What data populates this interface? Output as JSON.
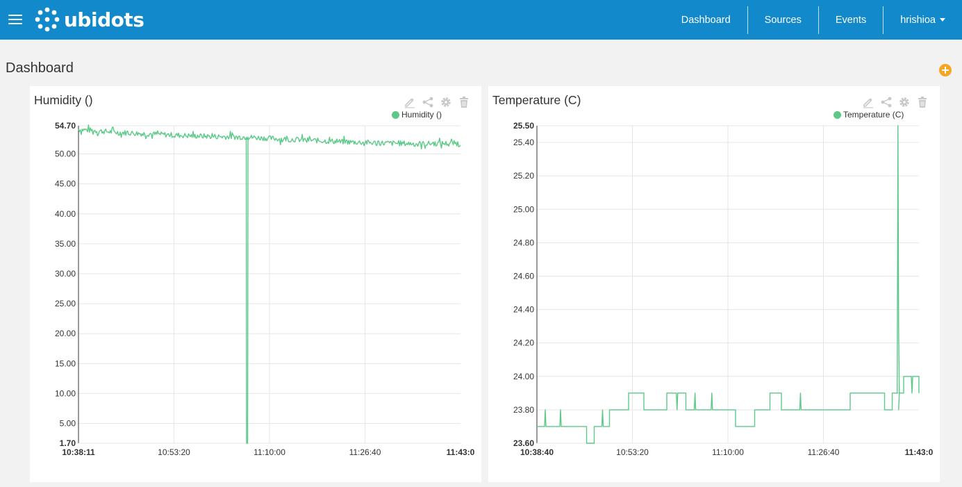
{
  "app": {
    "brand": "ubidots",
    "accent": "#1289ca"
  },
  "nav": {
    "dashboard": "Dashboard",
    "sources": "Sources",
    "events": "Events",
    "user": "hrishioa"
  },
  "page": {
    "title": "Dashboard"
  },
  "tools": [
    "edit-icon",
    "share-icon",
    "gear-icon",
    "trash-icon"
  ],
  "widgets": [
    {
      "title": "Humidity ()",
      "legend": "Humidity ()",
      "color": "#5bc987"
    },
    {
      "title": "Temperature (C)",
      "legend": "Temperature (C)",
      "color": "#5bc987"
    }
  ],
  "chart_data": [
    {
      "type": "line",
      "title": "Humidity ()",
      "series": [
        {
          "name": "Humidity ()"
        }
      ],
      "ylim": [
        1.7,
        54.7
      ],
      "yticks": [
        "1.70",
        "5.00",
        "10.00",
        "15.00",
        "20.00",
        "25.00",
        "30.00",
        "35.00",
        "40.00",
        "45.00",
        "50.00",
        "54.70"
      ],
      "xticks": [
        "10:38:11",
        "10:53:20",
        "11:10:00",
        "11:26:40",
        "11:43:0"
      ],
      "grid": true,
      "legend_position": "top-right",
      "x_range": [
        "10:38:11",
        "11:43:0"
      ],
      "baseline": [
        [
          0,
          54.1
        ],
        [
          0.1,
          53.6
        ],
        [
          0.2,
          53.3
        ],
        [
          0.3,
          53.0
        ],
        [
          0.44,
          52.8
        ],
        [
          0.5,
          52.6
        ],
        [
          0.6,
          52.3
        ],
        [
          0.7,
          52.0
        ],
        [
          0.8,
          51.8
        ],
        [
          0.9,
          51.7
        ],
        [
          1.0,
          51.8
        ]
      ],
      "noise": 0.45,
      "spikes": [
        {
          "x": 0.44,
          "y": 1.7
        }
      ]
    },
    {
      "type": "line",
      "title": "Temperature (C)",
      "series": [
        {
          "name": "Temperature (C)"
        }
      ],
      "ylim": [
        23.6,
        25.5
      ],
      "yticks": [
        "23.60",
        "23.80",
        "24.00",
        "24.20",
        "24.40",
        "24.60",
        "24.80",
        "25.00",
        "25.20",
        "25.40",
        "25.50"
      ],
      "xticks": [
        "10:38:40",
        "10:53:20",
        "11:10:00",
        "11:26:40",
        "11:43:0"
      ],
      "grid": true,
      "legend_position": "top-right",
      "x_range": [
        "10:38:40",
        "11:43:0"
      ],
      "steps": [
        [
          0.0,
          23.7
        ],
        [
          0.1,
          23.7
        ],
        [
          0.13,
          23.6
        ],
        [
          0.15,
          23.7
        ],
        [
          0.19,
          23.8
        ],
        [
          0.24,
          23.9
        ],
        [
          0.28,
          23.8
        ],
        [
          0.34,
          23.9
        ],
        [
          0.39,
          23.8
        ],
        [
          0.5,
          23.8
        ],
        [
          0.52,
          23.7
        ],
        [
          0.57,
          23.8
        ],
        [
          0.61,
          23.9
        ],
        [
          0.64,
          23.8
        ],
        [
          0.76,
          23.8
        ],
        [
          0.78,
          23.8
        ],
        [
          0.82,
          23.9
        ],
        [
          0.91,
          23.8
        ],
        [
          0.93,
          23.9
        ],
        [
          0.96,
          24.0
        ],
        [
          1.0,
          23.9
        ]
      ],
      "spikes": [
        {
          "x": 0.945,
          "y": 25.5
        }
      ]
    }
  ]
}
